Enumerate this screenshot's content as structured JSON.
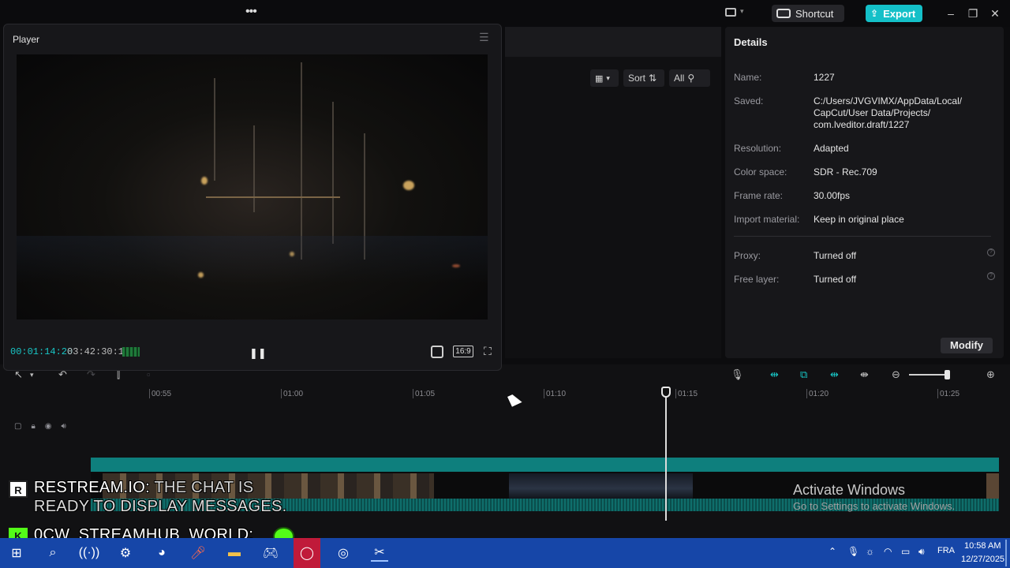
{
  "titlebar": {
    "dots": "•••",
    "shortcut_label": "Shortcut",
    "export_label": "Export"
  },
  "player": {
    "title": "Player",
    "current_time": "00:01:14:20",
    "total_time": "03:42:30:10",
    "ratio_label": "16:9"
  },
  "media": {
    "sort_label": "Sort",
    "filter_label": "All"
  },
  "details": {
    "heading": "Details",
    "rows": [
      {
        "label": "Name:",
        "value": "1227"
      },
      {
        "label": "Saved:",
        "value": "C:/Users/JVGVIMX/AppData/Local/ CapCut/User Data/Projects/ com.lveditor.draft/1227"
      },
      {
        "label": "Resolution:",
        "value": "Adapted"
      },
      {
        "label": "Color space:",
        "value": "SDR - Rec.709"
      },
      {
        "label": "Frame rate:",
        "value": "30.00fps"
      },
      {
        "label": "Import material:",
        "value": "Keep in original place"
      },
      {
        "label": "Proxy:",
        "value": "Turned off"
      },
      {
        "label": "Free layer:",
        "value": "Turned off"
      }
    ],
    "modify_label": "Modify"
  },
  "timeline": {
    "ticks": [
      "00:55",
      "01:00",
      "01:05",
      "01:10",
      "01:15",
      "01:20",
      "01:25"
    ]
  },
  "overlay": {
    "line1_name": "RESTREAM.IO:",
    "line1_msg": "THE CHAT IS",
    "line2": "READY TO DISPLAY MESSAGES.",
    "line3": "0CW_STREAMHUB_WORLD:",
    "badge_r": "R",
    "badge_k": "K"
  },
  "watermark": {
    "title": "Activate Windows",
    "subtitle": "Go to Settings to activate Windows."
  },
  "taskbar": {
    "lang": "FRA",
    "time": "10:58 AM",
    "date": "12/27/2025"
  },
  "colors": {
    "accent": "#18c6c6",
    "export": "#14c0c8",
    "taskbar": "#1646a8"
  }
}
